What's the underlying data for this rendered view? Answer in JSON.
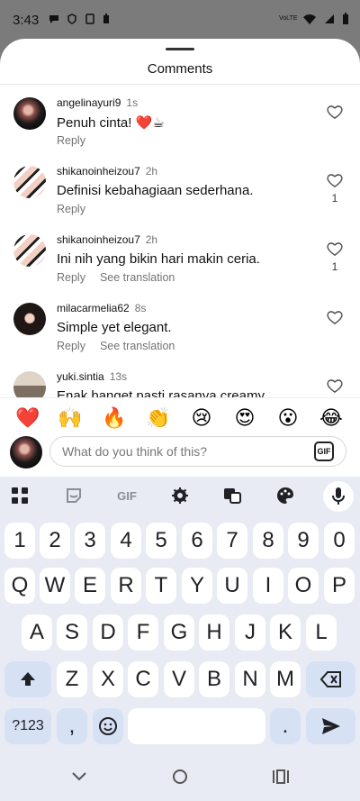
{
  "status_bar": {
    "time": "3:43",
    "right_text": "VoLTE",
    "icons": [
      "chat-bubble-icon",
      "shield-icon",
      "sync-icon",
      "battery-saver-icon",
      "wifi-icon",
      "signal-icon",
      "battery-icon"
    ]
  },
  "sheet": {
    "title": "Comments"
  },
  "comments": [
    {
      "username": "angelinayuri9",
      "time": "1s",
      "text": "Penuh cinta! ❤️☕",
      "actions": [
        "Reply"
      ],
      "likes": ""
    },
    {
      "username": "shikanoinheizou7",
      "time": "2h",
      "text": "Definisi kebahagiaan sederhana.",
      "actions": [
        "Reply"
      ],
      "likes": "1"
    },
    {
      "username": "shikanoinheizou7",
      "time": "2h",
      "text": "Ini nih yang bikin hari makin ceria.",
      "actions": [
        "Reply",
        "See translation"
      ],
      "likes": "1"
    },
    {
      "username": "milacarmelia62",
      "time": "8s",
      "text": "Simple yet elegant.",
      "actions": [
        "Reply",
        "See translation"
      ],
      "likes": ""
    },
    {
      "username": "yuki.sintia",
      "time": "13s",
      "text": "Enak banget pasti rasanya creamy.",
      "actions": [],
      "likes": ""
    }
  ],
  "reactions": [
    "❤️",
    "🙌",
    "🔥",
    "👏",
    "😢",
    "😍",
    "😮",
    "😂"
  ],
  "composer": {
    "placeholder": "What do you think of this?",
    "gif_label": "GIF"
  },
  "keyboard": {
    "toolbar": {
      "gif_label": "GIF",
      "icons": [
        "grid-icon",
        "sticker-icon",
        "settings-icon",
        "translate-icon",
        "palette-icon",
        "microphone-icon"
      ]
    },
    "number_row": [
      "1",
      "2",
      "3",
      "4",
      "5",
      "6",
      "7",
      "8",
      "9",
      "0"
    ],
    "row1": [
      "Q",
      "W",
      "E",
      "R",
      "T",
      "Y",
      "U",
      "I",
      "O",
      "P"
    ],
    "row2": [
      "A",
      "S",
      "D",
      "F",
      "G",
      "H",
      "J",
      "K",
      "L"
    ],
    "row3": [
      "Z",
      "X",
      "C",
      "V",
      "B",
      "N",
      "M"
    ],
    "symbols_label": "?123",
    "comma_label": ",",
    "period_label": "."
  },
  "nav": {
    "icons": [
      "back-icon",
      "home-icon",
      "recents-icon"
    ]
  }
}
